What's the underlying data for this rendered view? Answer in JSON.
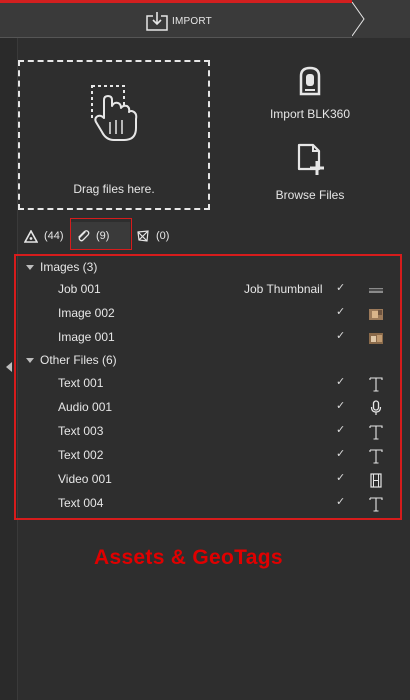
{
  "header": {
    "title": "IMPORT",
    "accent_color": "#d21f1f"
  },
  "dropzone": {
    "label": "Drag files here.",
    "icon": "hand-drop-icon"
  },
  "actions": {
    "import_blk": {
      "label": "Import BLK360",
      "icon": "blk360-device-icon"
    },
    "browse": {
      "label": "Browse Files",
      "icon": "file-plus-icon"
    }
  },
  "tabs": [
    {
      "icon": "geotag-triangle-icon",
      "count": "(44)"
    },
    {
      "icon": "paperclip-icon",
      "count": "(9)",
      "selected": true
    },
    {
      "icon": "share-network-icon",
      "count": "(0)"
    }
  ],
  "groups": {
    "images": {
      "label": "Images (3)",
      "items": [
        {
          "name": "Job 001",
          "extra": "Job Thumbnail",
          "checked": "✓",
          "icon": "job-thumbnail-icon"
        },
        {
          "name": "Image 002",
          "checked": "✓",
          "icon": "image-thumbnail-icon"
        },
        {
          "name": "Image 001",
          "checked": "✓",
          "icon": "image-thumbnail-icon"
        }
      ]
    },
    "other": {
      "label": "Other Files (6)",
      "items": [
        {
          "name": "Text 001",
          "checked": "✓",
          "icon": "text-T-icon"
        },
        {
          "name": "Audio 001",
          "checked": "✓",
          "icon": "microphone-icon"
        },
        {
          "name": "Text 003",
          "checked": "✓",
          "icon": "text-T-icon"
        },
        {
          "name": "Text 002",
          "checked": "✓",
          "icon": "text-T-icon"
        },
        {
          "name": "Video 001",
          "checked": "✓",
          "icon": "film-icon"
        },
        {
          "name": "Text 004",
          "checked": "✓",
          "icon": "text-T-icon"
        }
      ]
    }
  },
  "caption": "Assets & GeoTags",
  "highlight_color": "#d61c1c"
}
